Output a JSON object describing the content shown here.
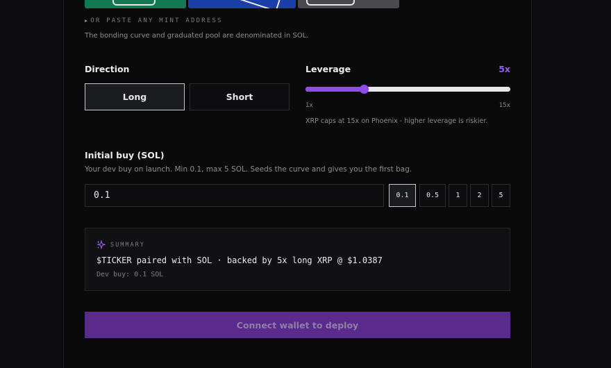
{
  "token_source": {
    "paste_label": "OR PASTE ANY MINT ADDRESS",
    "denomination_note": "The bonding curve and graduated pool are denominated in SOL."
  },
  "direction": {
    "label": "Direction",
    "options": [
      "Long",
      "Short"
    ],
    "selected": "Long"
  },
  "leverage": {
    "label": "Leverage",
    "value_label": "5x",
    "value": 5,
    "min_label": "1x",
    "max_label": "15x",
    "min": 1,
    "max": 15,
    "note": "XRP caps at 15x on Phoenix - higher leverage is riskier."
  },
  "initial_buy": {
    "label": "Initial buy (SOL)",
    "description": "Your dev buy on launch. Min 0.1, max 5 SOL. Seeds the curve and gives you the first bag.",
    "value": "0.1",
    "presets": [
      "0.1",
      "0.5",
      "1",
      "2",
      "5"
    ],
    "selected_preset": "0.1"
  },
  "summary": {
    "tag": "SUMMARY",
    "main": "$TICKER paired with SOL · backed by 5x long XRP @ $1.0387",
    "sub": "Dev buy: 0.1 SOL"
  },
  "deploy_button": {
    "label": "Connect wallet to deploy"
  },
  "colors": {
    "accent": "#8e4cea",
    "deploy_bg": "#5a2a8c"
  },
  "icons": {
    "summary": "sparkles-icon",
    "expand": "triangle-right-icon"
  }
}
